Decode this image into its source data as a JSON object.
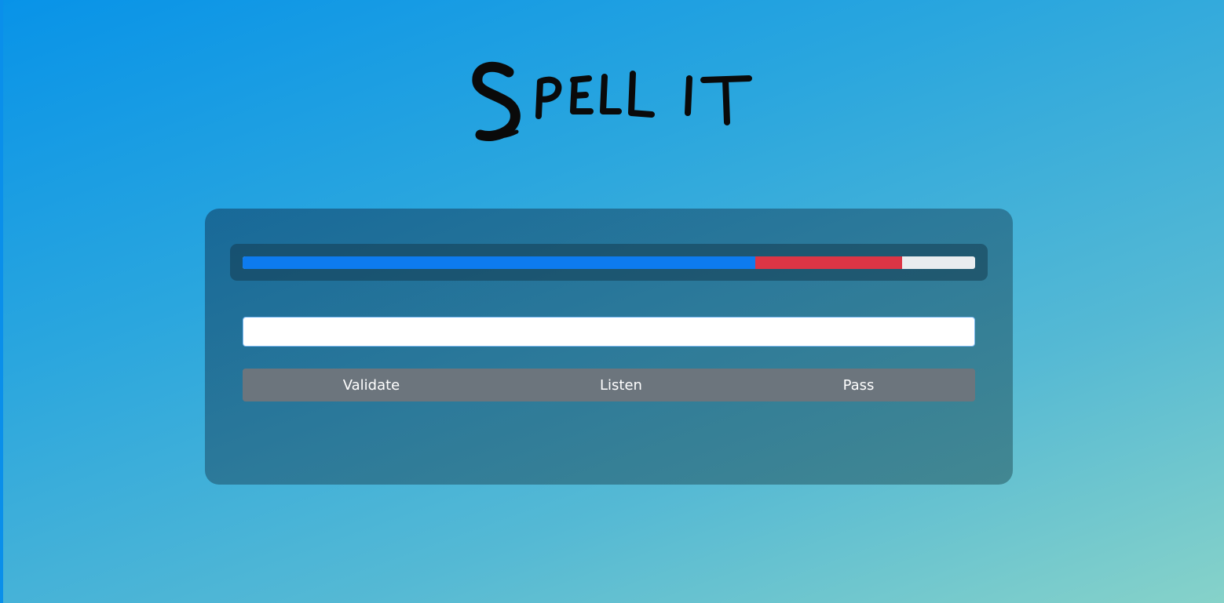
{
  "logo": {
    "text": "Spell it"
  },
  "progress": {
    "correct_fraction": 0.7,
    "wrong_fraction": 0.2,
    "colors": {
      "correct": "#0d7bef",
      "wrong": "#dc3545",
      "remaining": "#e9ecef"
    }
  },
  "answer": {
    "value": "",
    "placeholder": ""
  },
  "actions": {
    "validate_label": "Validate",
    "listen_label": "Listen",
    "pass_label": "Pass"
  }
}
